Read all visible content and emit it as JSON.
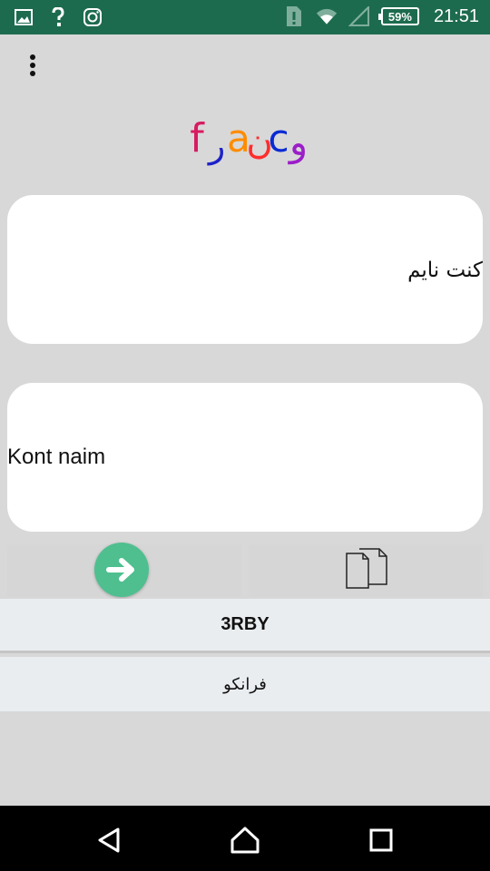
{
  "status_bar": {
    "time": "21:51",
    "battery": "59%",
    "icons": [
      "gallery-icon",
      "help-icon",
      "instagram-icon",
      "sim-alert-icon",
      "wifi-icon",
      "signal-icon",
      "battery-icon"
    ]
  },
  "toolbar": {
    "menu_icon": "more-vert-icon"
  },
  "logo": {
    "glyphs": [
      "f",
      "ر",
      "a",
      "ن",
      "c",
      "و"
    ],
    "colors": [
      "#d81b60",
      "#1e22c8",
      "#ff8c00",
      "#ff2d2d",
      "#0a2ad4",
      "#9b1ec8"
    ]
  },
  "input_panel": {
    "text": "كنت نايم"
  },
  "output_panel": {
    "text": "Kont naim"
  },
  "actions": {
    "convert_icon": "arrow-right-icon",
    "convert_color": "#4fbf8f",
    "copy_icon": "copy-icon"
  },
  "options": {
    "option_1": "3RBY",
    "option_2": "فرانكو"
  },
  "navigation": {
    "icons": [
      "back-icon",
      "home-icon",
      "recent-apps-icon"
    ]
  }
}
